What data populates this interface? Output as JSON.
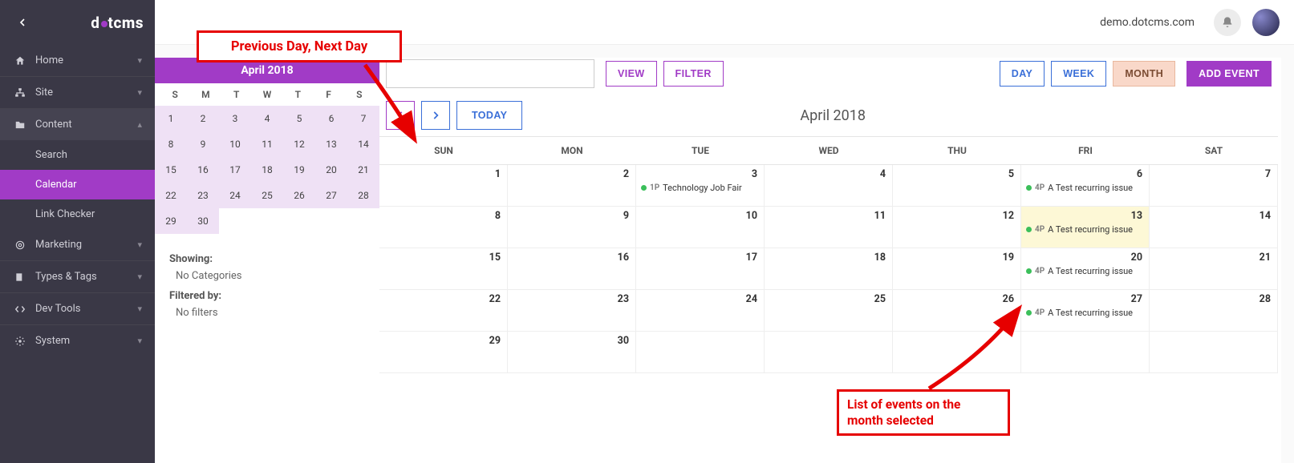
{
  "brand": {
    "part1": "d",
    "part2": "t",
    "part3": "cms"
  },
  "header": {
    "domain": "demo.dotcms.com"
  },
  "sidebar": {
    "items": [
      {
        "label": "Home"
      },
      {
        "label": "Site"
      },
      {
        "label": "Content"
      },
      {
        "label": "Marketing"
      },
      {
        "label": "Types & Tags"
      },
      {
        "label": "Dev Tools"
      },
      {
        "label": "System"
      }
    ],
    "content_sub": [
      {
        "label": "Search"
      },
      {
        "label": "Calendar"
      },
      {
        "label": "Link Checker"
      }
    ]
  },
  "mini_cal": {
    "title": "April 2018",
    "dow": [
      "S",
      "M",
      "T",
      "W",
      "T",
      "F",
      "S"
    ],
    "weeks": [
      [
        {
          "n": "1",
          "in": true
        },
        {
          "n": "2",
          "in": true
        },
        {
          "n": "3",
          "in": true
        },
        {
          "n": "4",
          "in": true
        },
        {
          "n": "5",
          "in": true
        },
        {
          "n": "6",
          "in": true
        },
        {
          "n": "7",
          "in": true
        }
      ],
      [
        {
          "n": "8",
          "in": true
        },
        {
          "n": "9",
          "in": true
        },
        {
          "n": "10",
          "in": true
        },
        {
          "n": "11",
          "in": true
        },
        {
          "n": "12",
          "in": true
        },
        {
          "n": "13",
          "in": true
        },
        {
          "n": "14",
          "in": true
        }
      ],
      [
        {
          "n": "15",
          "in": true
        },
        {
          "n": "16",
          "in": true
        },
        {
          "n": "17",
          "in": true
        },
        {
          "n": "18",
          "in": true
        },
        {
          "n": "19",
          "in": true
        },
        {
          "n": "20",
          "in": true
        },
        {
          "n": "21",
          "in": true
        }
      ],
      [
        {
          "n": "22",
          "in": true
        },
        {
          "n": "23",
          "in": true
        },
        {
          "n": "24",
          "in": true
        },
        {
          "n": "25",
          "in": true
        },
        {
          "n": "26",
          "in": true
        },
        {
          "n": "27",
          "in": true
        },
        {
          "n": "28",
          "in": true
        }
      ],
      [
        {
          "n": "29",
          "in": true
        },
        {
          "n": "30",
          "in": true
        },
        {
          "n": "",
          "in": false
        },
        {
          "n": "",
          "in": false
        },
        {
          "n": "",
          "in": false
        },
        {
          "n": "",
          "in": false
        },
        {
          "n": "",
          "in": false
        }
      ]
    ],
    "showing_label": "Showing:",
    "showing_value": "No Categories",
    "filtered_label": "Filtered by:",
    "filtered_value": "No filters"
  },
  "toolbar": {
    "view": "VIEW",
    "filter": "FILTER",
    "day": "DAY",
    "week": "WEEK",
    "month": "MONTH",
    "add": "ADD EVENT",
    "today": "TODAY"
  },
  "big_cal": {
    "title": "April 2018",
    "dow": [
      "SUN",
      "MON",
      "TUE",
      "WED",
      "THU",
      "FRI",
      "SAT"
    ],
    "rows": [
      [
        {
          "n": "1"
        },
        {
          "n": "2"
        },
        {
          "n": "3",
          "ev": {
            "t": "1P",
            "txt": "Technology Job Fair"
          }
        },
        {
          "n": "4"
        },
        {
          "n": "5"
        },
        {
          "n": "6",
          "ev": {
            "t": "4P",
            "txt": "A Test recurring issue"
          }
        },
        {
          "n": "7"
        }
      ],
      [
        {
          "n": "8"
        },
        {
          "n": "9"
        },
        {
          "n": "10"
        },
        {
          "n": "11"
        },
        {
          "n": "12"
        },
        {
          "n": "13",
          "hl": true,
          "ev": {
            "t": "4P",
            "txt": "A Test recurring issue"
          }
        },
        {
          "n": "14"
        }
      ],
      [
        {
          "n": "15"
        },
        {
          "n": "16"
        },
        {
          "n": "17"
        },
        {
          "n": "18"
        },
        {
          "n": "19"
        },
        {
          "n": "20",
          "ev": {
            "t": "4P",
            "txt": "A Test recurring issue"
          }
        },
        {
          "n": "21"
        }
      ],
      [
        {
          "n": "22"
        },
        {
          "n": "23"
        },
        {
          "n": "24"
        },
        {
          "n": "25"
        },
        {
          "n": "26"
        },
        {
          "n": "27",
          "ev": {
            "t": "4P",
            "txt": "A Test recurring issue"
          }
        },
        {
          "n": "28"
        }
      ],
      [
        {
          "n": "29"
        },
        {
          "n": "30"
        },
        {
          "n": ""
        },
        {
          "n": ""
        },
        {
          "n": ""
        },
        {
          "n": ""
        },
        {
          "n": ""
        }
      ]
    ]
  },
  "annotations": {
    "prevnext": "Previous Day, Next Day",
    "events": "List of events on the month selected"
  }
}
